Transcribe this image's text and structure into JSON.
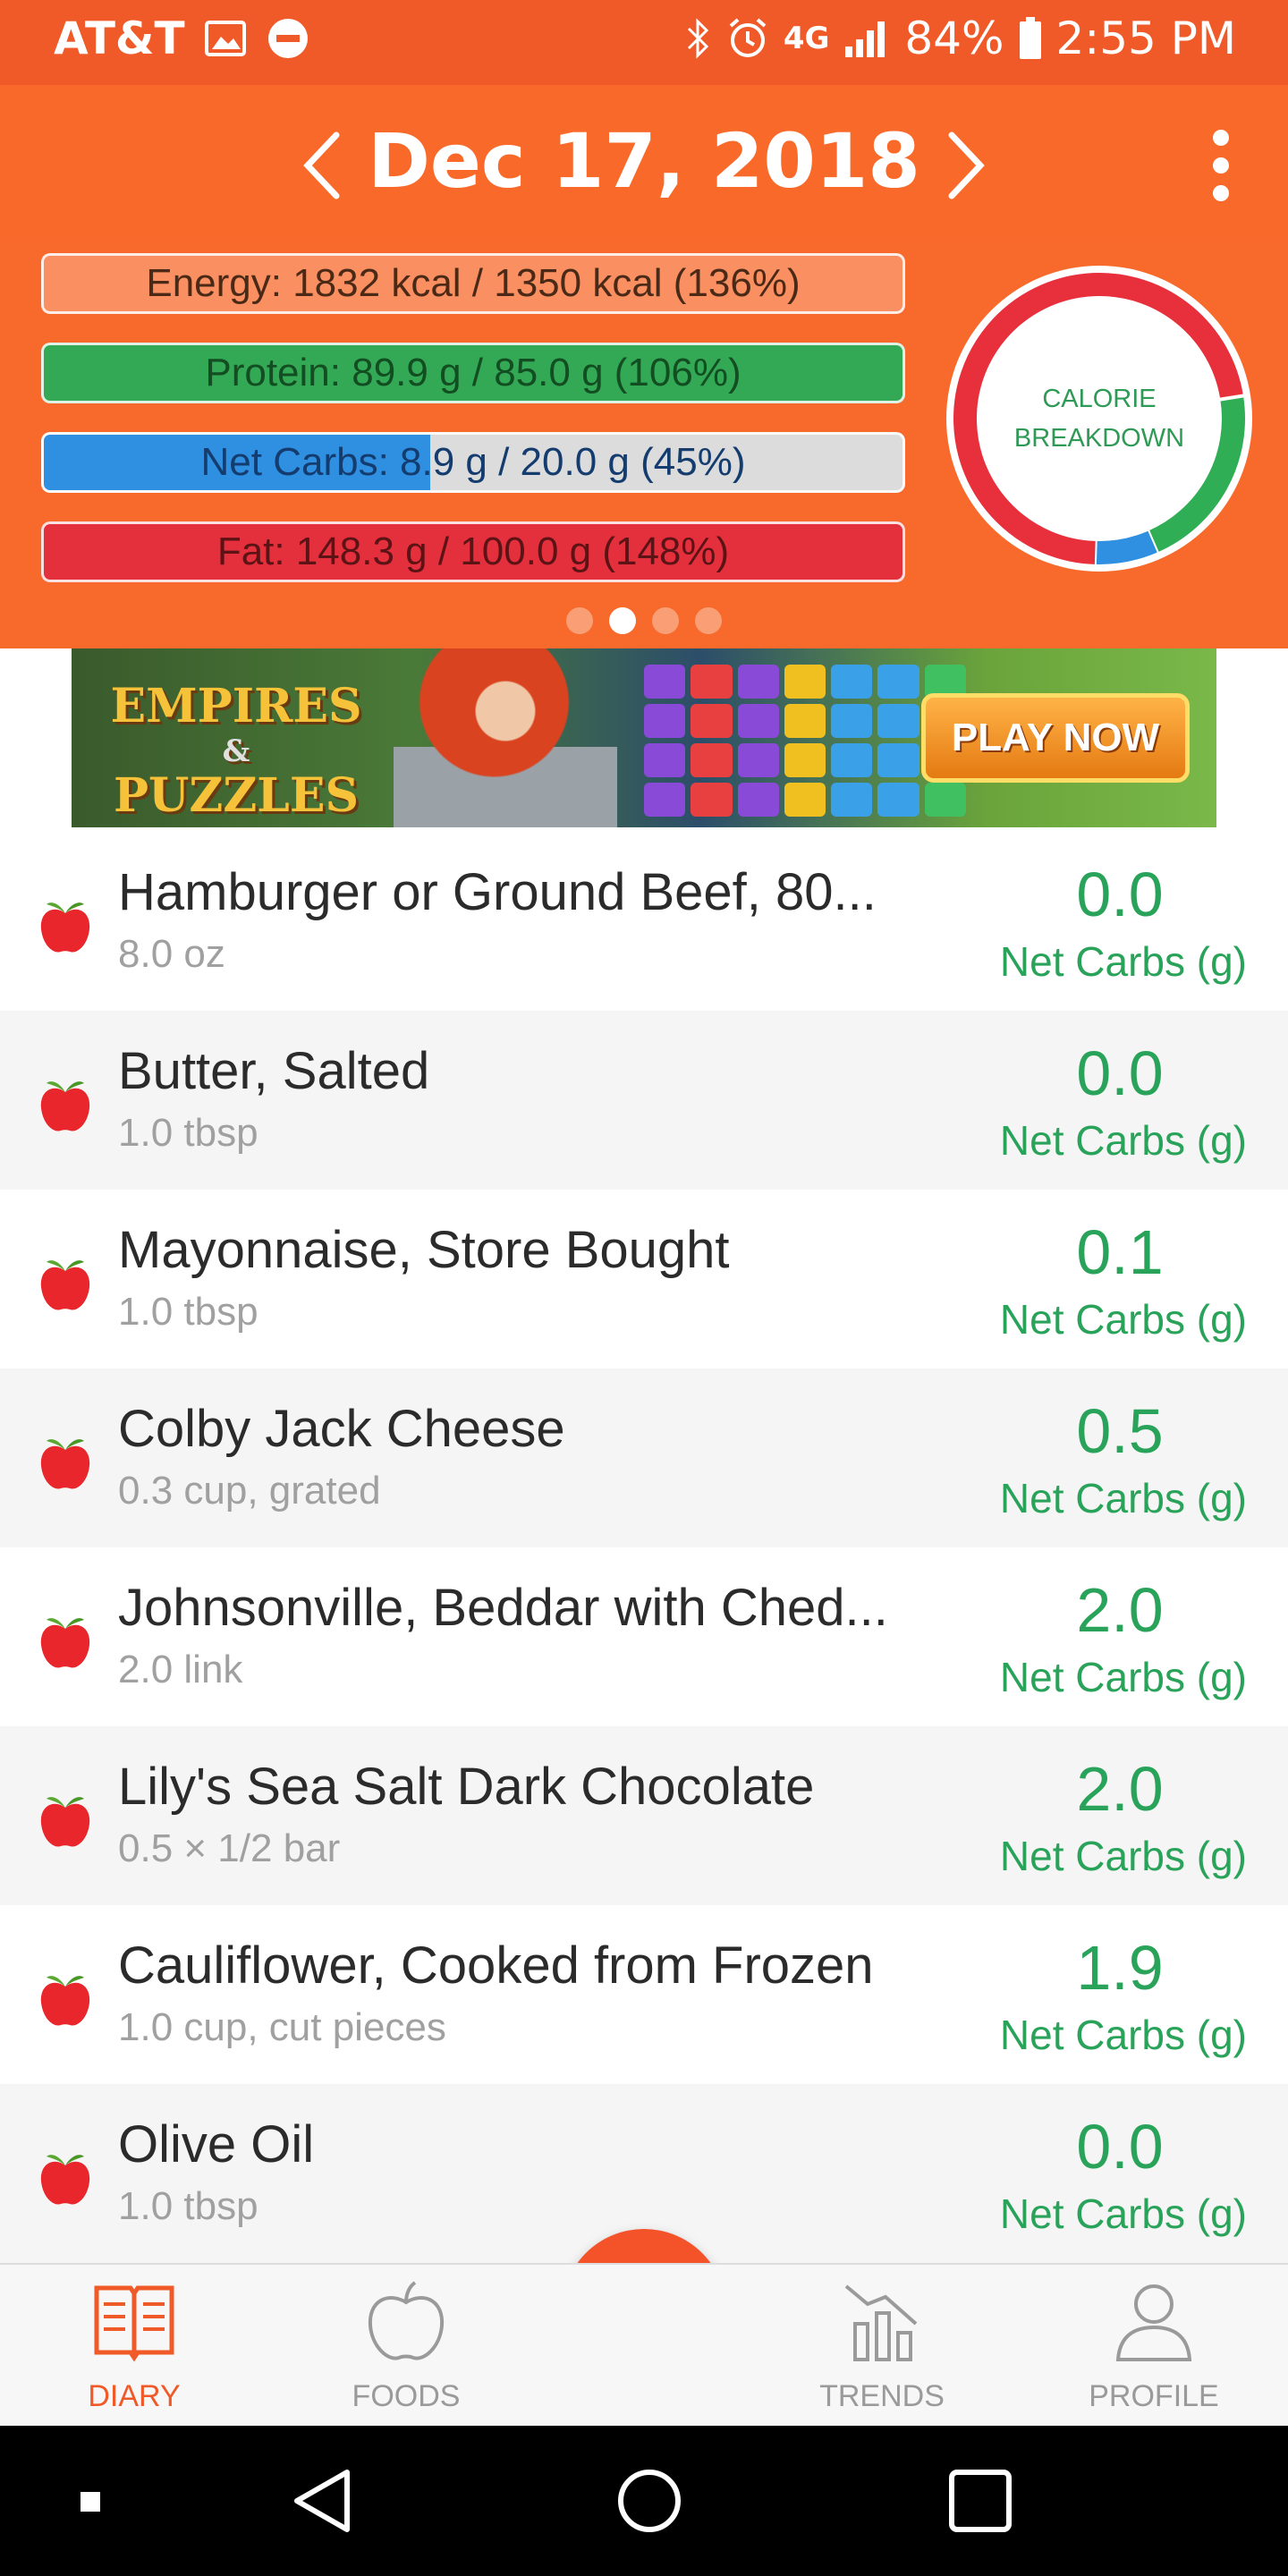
{
  "status_bar": {
    "carrier": "AT&T",
    "network": "4G",
    "battery": "84%",
    "time": "2:55 PM"
  },
  "header": {
    "date": "Dec 17, 2018"
  },
  "macros": {
    "energy": {
      "label": "Energy: 1832 kcal  /  1350 kcal (136%)",
      "progress": 1.0,
      "color": "#fa8f62"
    },
    "protein": {
      "label": "Protein: 89.9 g  /  85.0 g (106%)",
      "progress": 1.0,
      "color": "#33a955"
    },
    "net_carbs": {
      "label": "Net Carbs: 8.9 g  /  20.0 g (45%)",
      "progress": 0.45,
      "color": "#2f8fe0"
    },
    "fat": {
      "label": "Fat: 148.3 g  /  100.0 g (148%)",
      "progress": 1.0,
      "color": "#e42f3c"
    }
  },
  "calorie_breakdown": {
    "line1": "CALORIE",
    "line2": "BREAKDOWN",
    "segments": [
      {
        "name": "fat",
        "fraction": 0.72,
        "color": "#e8303c"
      },
      {
        "name": "carbs",
        "fraction": 0.07,
        "color": "#2f8fe0"
      },
      {
        "name": "protein",
        "fraction": 0.21,
        "color": "#2fae55"
      }
    ]
  },
  "pager": {
    "count": 4,
    "active_index": 1
  },
  "ad": {
    "logo_line1": "EMPIRES",
    "logo_amp": "&",
    "logo_line2": "PUZZLES",
    "cta": "PLAY NOW"
  },
  "foods": [
    {
      "name": "Hamburger or Ground Beef, 80...",
      "qty": "8.0 oz",
      "value": "0.0",
      "unit": "Net Carbs (g)"
    },
    {
      "name": "Butter, Salted",
      "qty": "1.0 tbsp",
      "value": "0.0",
      "unit": "Net Carbs (g)"
    },
    {
      "name": "Mayonnaise, Store Bought",
      "qty": "1.0 tbsp",
      "value": "0.1",
      "unit": "Net Carbs (g)"
    },
    {
      "name": "Colby Jack Cheese",
      "qty": "0.3 cup, grated",
      "value": "0.5",
      "unit": "Net Carbs (g)"
    },
    {
      "name": "Johnsonville, Beddar with Ched...",
      "qty": "2.0 link",
      "value": "2.0",
      "unit": "Net Carbs (g)"
    },
    {
      "name": "Lily's Sea Salt Dark Chocolate",
      "qty": "0.5 × 1/2 bar",
      "value": "2.0",
      "unit": "Net Carbs (g)"
    },
    {
      "name": "Cauliflower, Cooked from Frozen",
      "qty": "1.0 cup, cut pieces",
      "value": "1.9",
      "unit": "Net Carbs (g)"
    },
    {
      "name": "Olive Oil",
      "qty": "1.0 tbsp",
      "value": "0.0",
      "unit": "Net Carbs (g)"
    }
  ],
  "bottom_nav": {
    "diary": "DIARY",
    "foods": "FOODS",
    "trends": "TRENDS",
    "profile": "PROFILE"
  },
  "colors": {
    "accent": "#f96a2a",
    "status_bar": "#f05a28",
    "value_green": "#2aa35a",
    "fab": "#f4532a"
  }
}
